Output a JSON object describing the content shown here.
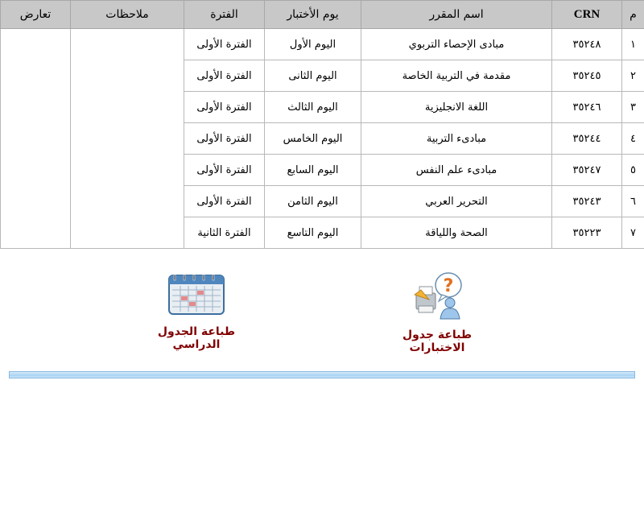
{
  "headers": {
    "index": "م",
    "crn": "CRN",
    "course": "اسم المقرر",
    "day": "يوم الأختبار",
    "period": "الفترة",
    "notes": "ملاحظات",
    "conflict": "تعارض"
  },
  "rows": [
    {
      "idx": "١",
      "crn": "٣٥٢٤٨",
      "course": "مبادى الإحصاء التربوي",
      "day": "اليوم الأول",
      "period": "الفترة الأولى"
    },
    {
      "idx": "٢",
      "crn": "٣٥٢٤٥",
      "course": "مقدمة في التربية الخاصة",
      "day": "اليوم الثانى",
      "period": "الفترة الأولى"
    },
    {
      "idx": "٣",
      "crn": "٣٥٢٤٦",
      "course": "اللغة الانجليزية",
      "day": "اليوم الثالث",
      "period": "الفترة الأولى"
    },
    {
      "idx": "٤",
      "crn": "٣٥٢٤٤",
      "course": "مبادىء التربية",
      "day": "اليوم الخامس",
      "period": "الفترة الأولى"
    },
    {
      "idx": "٥",
      "crn": "٣٥٢٤٧",
      "course": "مبادىء علم النفس",
      "day": "اليوم السابع",
      "period": "الفترة الأولى"
    },
    {
      "idx": "٦",
      "crn": "٣٥٢٤٣",
      "course": "التحرير العربي",
      "day": "اليوم الثامن",
      "period": "الفترة الأولى"
    },
    {
      "idx": "٧",
      "crn": "٣٥٢٢٣",
      "course": "الصحة واللياقة",
      "day": "اليوم التاسع",
      "period": "الفترة الثانية"
    }
  ],
  "actions": {
    "print_exams": "طباعة جدول الاختبارات",
    "print_schedule": "طباعة الجدول الدراسي"
  },
  "icons": {
    "print_exams": "help-question-user-icon",
    "print_schedule": "calendar-icon"
  },
  "colors": {
    "header_bg": "#c8c8c8",
    "link_text": "#800000",
    "bar": "#a9d3f3"
  }
}
